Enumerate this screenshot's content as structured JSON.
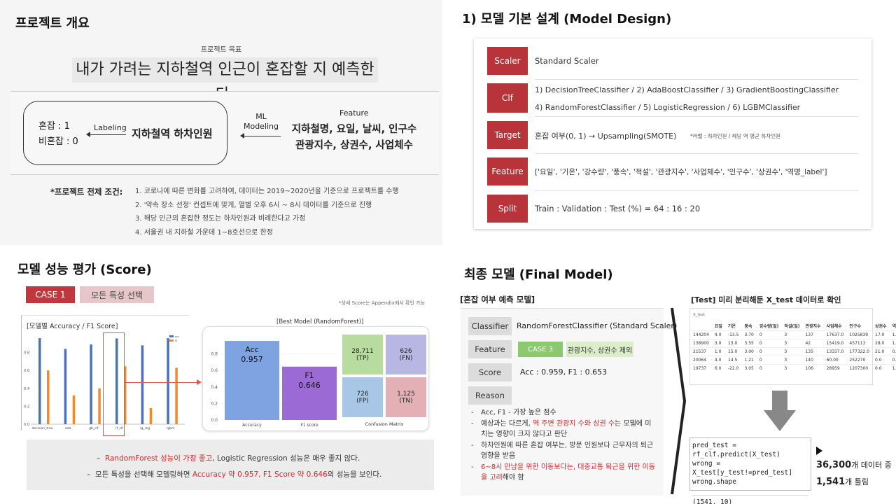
{
  "q1": {
    "title": "프로젝트 개요",
    "goal_label": "프로젝트 목표",
    "goal_text": "내가 가려는 지하철역 인근이 혼잡할 지 예측한다.",
    "labels": [
      "혼잡 : 1",
      "비혼잡 : 0"
    ],
    "labeling": "Labeling",
    "target_text": "지하철역 하차인원",
    "ml": "ML",
    "modeling": "Modeling",
    "feature_title": "Feature",
    "feature_line1": "지하철명, 요일, 날씨, 인구수",
    "feature_line2": "관광지수, 상권수, 사업체수",
    "cond_title": "*프로젝트 전제 조건:",
    "conds": [
      "1. 코로나에 따른 변화를 고려하여, 데이터는 2019~2020년을 기준으로 프로젝트를 수행",
      "2. '약속 장소 선정' 컨셉트에 맞게, 열별 오후 6시 ~ 8시 데이터를 기준으로 진행",
      "3. 해당 인근의 혼잡한 정도는 하차인원과 비례한다고 가정",
      "4. 서울권 내 지하철 가운데 1~8호선으로 한정"
    ]
  },
  "q2": {
    "title": "1) 모델 기본 설계 (Model Design)",
    "rows": [
      {
        "label": "Scaler",
        "text": "Standard Scaler"
      },
      {
        "label": "Clf",
        "text": "1) DecisionTreeClassifier  /  2) AdaBoostClassifier  /  3) GradientBoostingClassifier",
        "text2": "4) RandomForestClassifier  /  5) LogisticRegression  /  6) LGBMClassifier"
      },
      {
        "label": "Target",
        "text": "혼잡 여부(0, 1) → Upsampling(SMOTE)",
        "note": "*라벨 : 하차인원 / 해당 역 평균 하차인원"
      },
      {
        "label": "Feature",
        "text": "['요일', '기온', '강수량', '풍속', '적설', '관광지수', '사업체수', '인구수', '상권수', '역명_label']"
      },
      {
        "label": "Split",
        "text": "Train : Validation : Test (%) = 64 : 16 : 20"
      }
    ]
  },
  "q3": {
    "title": "모델 성능 평가 (Score)",
    "case": "CASE 1",
    "case_desc": "모든 특성 선택",
    "appendix_note": "*상세 Score는 Appendix에서 확인 가능",
    "left_chart_title": "[모델별 Accuracy / F1 Score]",
    "best_title": "[Best Model (RandomForest)]",
    "acc_label": "Acc",
    "acc_value": "0.957",
    "f1_label": "F1",
    "f1_value": "0.646",
    "acc_axis": "Accuracy",
    "f1_axis": "F1 score",
    "cm_title": "Confusion Matrix",
    "cm": [
      {
        "v": "28,711",
        "k": "(TP)"
      },
      {
        "v": "626",
        "k": "(FN)"
      },
      {
        "v": "726",
        "k": "(FP)"
      },
      {
        "v": "1,125",
        "k": "(TN)"
      }
    ],
    "note1_a": "RandomForest 성능이 가장 좋고",
    "note1_b": ", Logistic Regression 성능은 매우 좋지 않다.",
    "note2_a": "모든 특성을 선택해 모델링하면 ",
    "note2_b": "Accuracy 약 0.957, F1 Score 약 0.646",
    "note2_c": "의 성능을 보인다."
  },
  "chart_data": [
    {
      "type": "bar",
      "title": "[모델별 Accuracy / F1 Score]",
      "categories": [
        "decision_tree",
        "ada",
        "gb_clf",
        "rf_clf",
        "lg_reg",
        "lgbm"
      ],
      "series": [
        {
          "name": "acc",
          "values": [
            0.96,
            0.84,
            0.89,
            0.957,
            0.88,
            0.96
          ]
        },
        {
          "name": "f1",
          "values": [
            0.6,
            0.32,
            0.4,
            0.646,
            0.18,
            0.63
          ]
        }
      ],
      "ylim": [
        0,
        1
      ],
      "yticks": [
        "0.0",
        "0.2",
        "0.4",
        "0.6",
        "0.8"
      ],
      "colors": [
        "#4a72b8",
        "#ef8a33"
      ]
    },
    {
      "type": "bar",
      "title": "[Best Model (RandomForest)]",
      "categories": [
        "Accuracy",
        "F1 score"
      ],
      "values": [
        0.957,
        0.646
      ],
      "ylim": [
        0,
        1
      ],
      "yticks": [
        "0.0",
        "0.2",
        "0.4",
        "0.6",
        "0.8"
      ],
      "colors": [
        "#7ea3e0",
        "#9c6ad4"
      ]
    }
  ],
  "q4": {
    "title": "최종 모델 (Final Model)",
    "left_head": "[혼잡 여부 예측 모델]",
    "right_head": "[Test] 미리 분리해둔 X_test 데이터로 확인",
    "classifier_label": "Classifier",
    "classifier_value": "RandomForestClassifier (Standard Scaler)",
    "feature_label": "Feature",
    "case3": "CASE 3",
    "feature_value": "관광지수, 상권수 제외",
    "score_label": "Score",
    "score_value": "Acc : 0.959, F1 : 0.653",
    "reason_label": "Reason",
    "reasons": [
      "Acc, F1 - 가장 높은 점수",
      "예상과는 다르게, 역 주변 관광지 수와 상권 수는 모델에 미치는 영향이 크지 않다고 판단",
      "하차인원에 따른 혼잡 여부는, 방문 인원보다 근무자의 퇴근 영향을 받음",
      "6~8시 만남을 위한 이동보다는, 대중교통 퇴근을 위한 이동을 고려해야 함"
    ],
    "reason2_red": "역 주변 관광지 수와 상권 수",
    "reason4_red": "6~8시 만남을 위한 이동보다는, 대중교통 퇴근을 위한 이동을 고려",
    "table_label": "X_test",
    "table_header": [
      "",
      "요일",
      "기온",
      "풍속",
      "강수량(일)",
      "적설(일)",
      "관광지수",
      "사업체수",
      "인구수",
      "상권수",
      "역명_label"
    ],
    "table_rows": [
      [
        "144204",
        "4.0",
        "-13.5",
        "3.70",
        "0",
        "3",
        "137",
        "17637.0",
        "1025839",
        "17.0",
        "1.0"
      ],
      [
        "138900",
        "3.0",
        "13.0",
        "3.55",
        "0",
        "3",
        "42",
        "15419.0",
        "457113",
        "28.0",
        "1.0"
      ],
      [
        "21537",
        "1.0",
        "15.0",
        "3.00",
        "0",
        "3",
        "135",
        "13337.0",
        "177322.0",
        "21.0",
        "0.0"
      ],
      [
        "20064",
        "4.0",
        "14.5",
        "1.21",
        "0",
        "3",
        "140",
        "60.00",
        "252270",
        "0.0",
        "0.0"
      ],
      [
        "19737",
        "6.0",
        "-22.0",
        "3.05",
        "0",
        "3",
        "106",
        "28959",
        "1207300",
        "0.0",
        "1.0"
      ]
    ],
    "code_lines": [
      "pred_test = rf_clf.predict(X_test)",
      "wrong = X_test[y_test!=pred_test]",
      "wrong.shape"
    ],
    "code_output": "(1541, 10)",
    "result1_num": "36,300",
    "result1_txt": "개 데이터 중",
    "result2_num": "1,541",
    "result2_txt": "개 틀림"
  }
}
